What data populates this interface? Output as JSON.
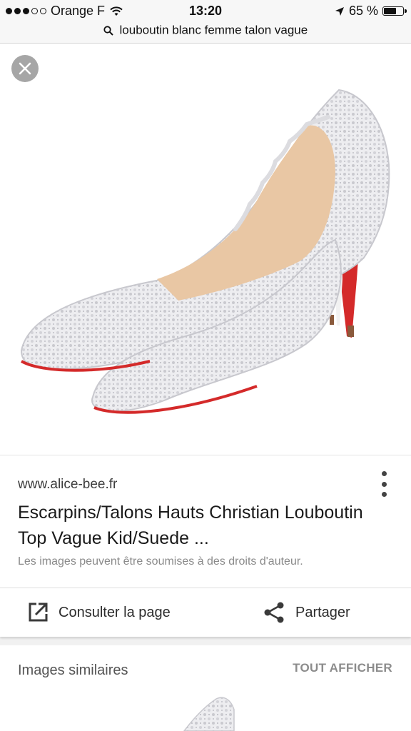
{
  "status_bar": {
    "carrier": "Orange F",
    "time": "13:20",
    "battery_percent": "65 %",
    "battery_level": 0.65,
    "signal_bars_filled": 3,
    "signal_bars_total": 5
  },
  "search": {
    "query": "louboutin blanc femme talon vague"
  },
  "result": {
    "site": "www.alice-bee.fr",
    "title": "Escarpins/Talons Hauts Christian Louboutin Top Vague Kid/Suede ...",
    "rights_notice": "Les images peuvent être soumises à des droits d'auteur."
  },
  "actions": {
    "open_label": "Consulter la page",
    "share_label": "Partager"
  },
  "similar": {
    "label": "Images similaires",
    "show_all": "TOUT AFFICHER"
  },
  "colors": {
    "sole_red": "#d42a2a",
    "nude_lining": "#e9c7a4",
    "crystal": "#e6e6ea"
  }
}
